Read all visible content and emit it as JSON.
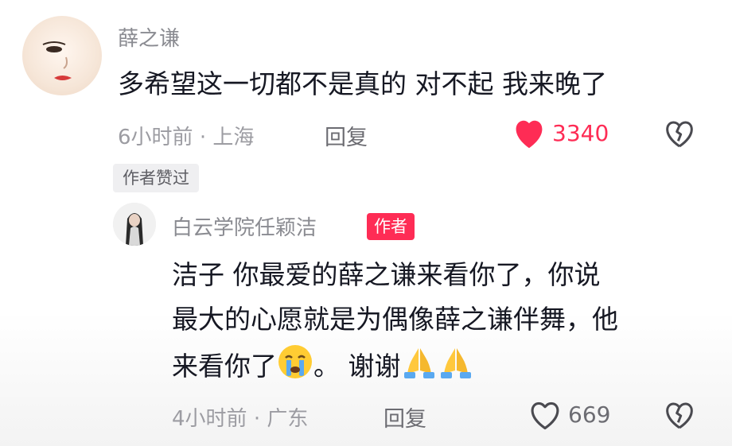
{
  "comment": {
    "username": "薛之谦",
    "text": "多希望这一切都不是真的 对不起 我来晚了",
    "time": "6小时前",
    "location": "上海",
    "reply_label": "回复",
    "like_count": "3340",
    "liked": true,
    "author_liked_tag": "作者赞过"
  },
  "reply_comment": {
    "username": "白云学院任颖洁",
    "author_tag": "作者",
    "text_line1": "洁子 你最爱的薛之谦来看你了，你说",
    "text_line2": "最大的心愿就是为偶像薛之谦伴舞，他",
    "text_line3_a": "来看你了",
    "text_line3_b": "。 谢谢",
    "time": "4小时前",
    "location": "广东",
    "reply_label": "回复",
    "like_count": "669",
    "liked": false
  },
  "colors": {
    "like_red": "#fe2c55",
    "meta_gray": "#9c9ca2"
  },
  "icons": [
    "heart-icon",
    "dislike-broken-heart-icon",
    "crying-emoji",
    "praying-hands-emoji"
  ]
}
